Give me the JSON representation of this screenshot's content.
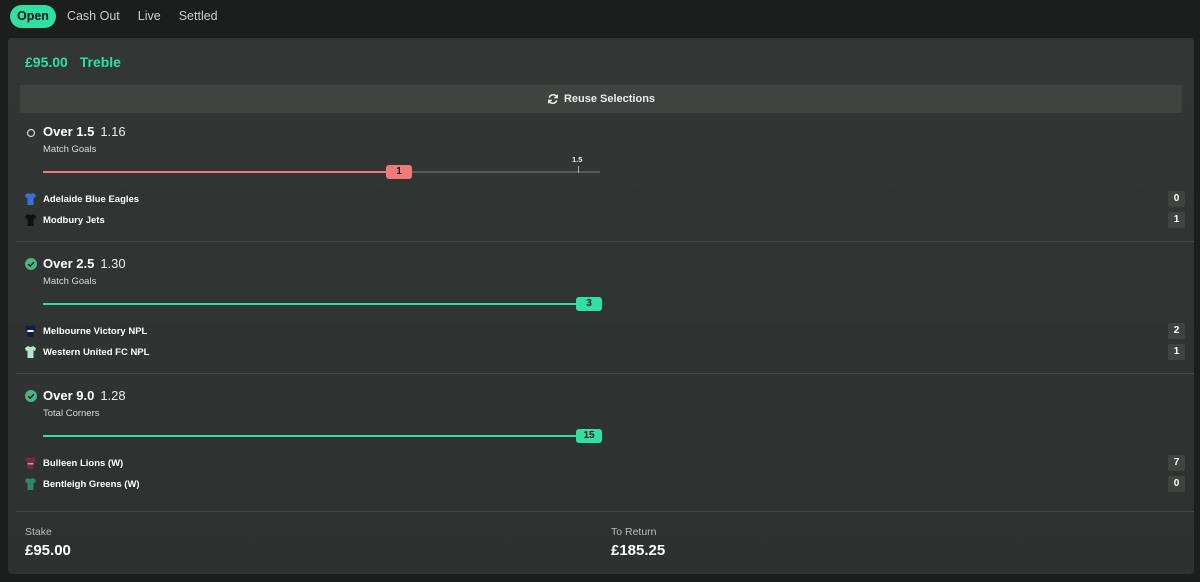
{
  "tabs": [
    {
      "label": "Open",
      "active": true
    },
    {
      "label": "Cash Out",
      "active": false
    },
    {
      "label": "Live",
      "active": false
    },
    {
      "label": "Settled",
      "active": false
    }
  ],
  "bet": {
    "stake_label": "£95.00",
    "type": "Treble",
    "reuse_label": "Reuse Selections",
    "accent_color": "#2fe0a2",
    "lose_color": "#f07a7a"
  },
  "legs": [
    {
      "selection": "Over 1.5",
      "odds": "1.16",
      "market": "Match Goals",
      "status": "pending",
      "status_icon": "open-circle-icon",
      "progress_value": "1",
      "progress_fraction": 0.64,
      "threshold_label": "1.5",
      "teams": [
        {
          "name": "Adelaide Blue Eagles",
          "score": "0",
          "shirt_color": "#3b6fd1"
        },
        {
          "name": "Modbury Jets",
          "score": "1",
          "shirt_color": "#111111"
        }
      ]
    },
    {
      "selection": "Over 2.5",
      "odds": "1.30",
      "market": "Match Goals",
      "status": "won",
      "status_icon": "check-circle-icon",
      "progress_value": "3",
      "progress_fraction": 1,
      "threshold_label": "",
      "teams": [
        {
          "name": "Melbourne Victory NPL",
          "score": "2",
          "shirt_color": "#0c1f4a"
        },
        {
          "name": "Western United FC NPL",
          "score": "1",
          "shirt_color": "#b9e6c3"
        }
      ]
    },
    {
      "selection": "Over 9.0",
      "odds": "1.28",
      "market": "Total Corners",
      "status": "won",
      "status_icon": "check-circle-icon",
      "progress_value": "15",
      "progress_fraction": 1,
      "threshold_label": "",
      "teams": [
        {
          "name": "Bulleen Lions (W)",
          "score": "7",
          "shirt_color": "#7a2747"
        },
        {
          "name": "Bentleigh Greens (W)",
          "score": "0",
          "shirt_color": "#2f8a5b"
        }
      ]
    }
  ],
  "footer": {
    "stake_label": "Stake",
    "stake_value": "£95.00",
    "return_label": "To Return",
    "return_value": "£185.25"
  }
}
